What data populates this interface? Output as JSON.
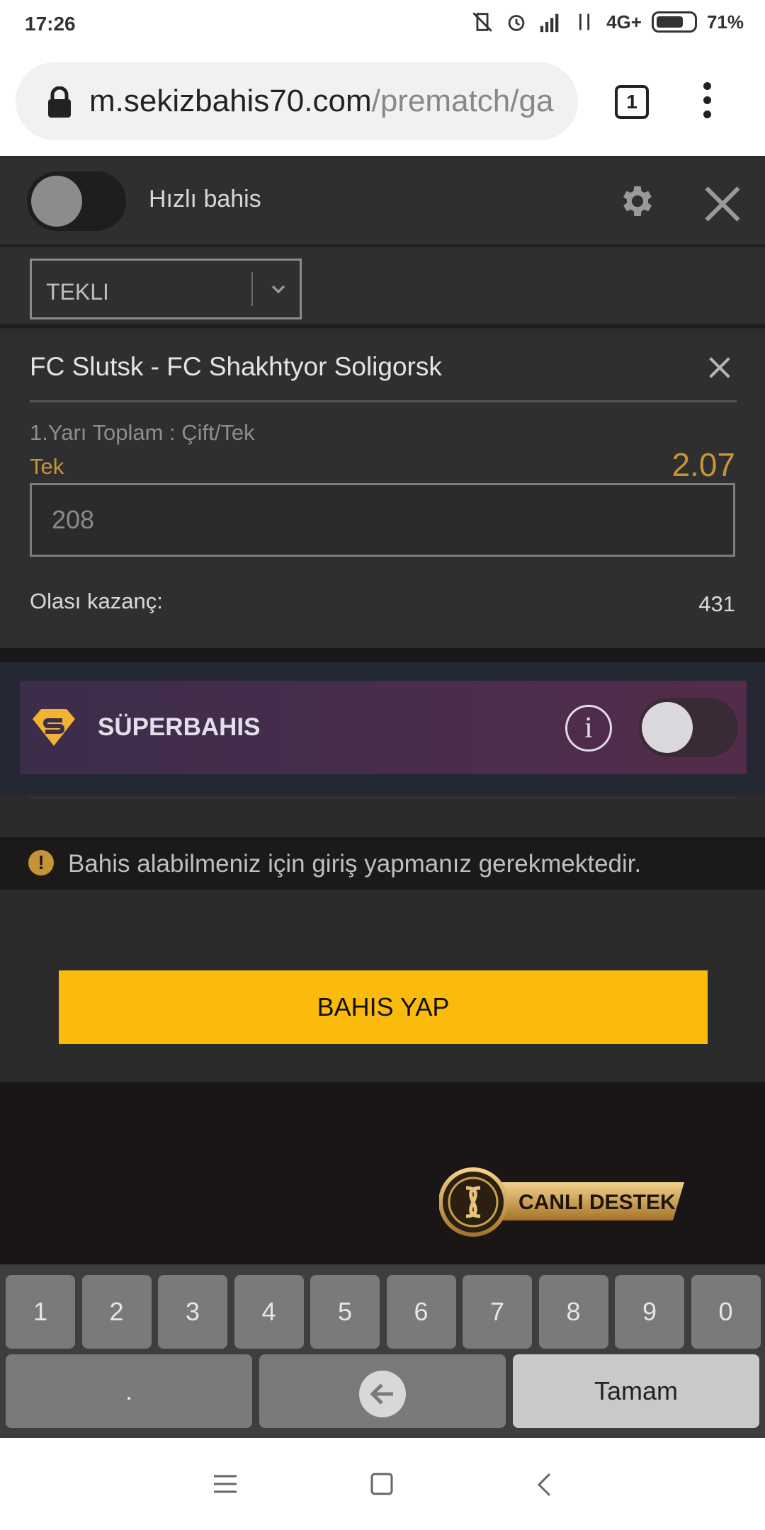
{
  "status_bar": {
    "time": "17:26",
    "network": "4G+",
    "battery": "71%",
    "battery_level": 0.71
  },
  "browser": {
    "url_host": "m.sekizbahis70.com",
    "url_path": "/prematch/ga",
    "tab_count": "1"
  },
  "betslip": {
    "quick_bet_label": "Hızlı bahis",
    "bet_type": "TEKLI",
    "match": "FC Slutsk - FC Shakhtyor Soligorsk",
    "market": "1.Yarı Toplam : Çift/Tek",
    "selection": "Tek",
    "odds": "2.07",
    "stake_value": "208",
    "payout_label": "Olası kazanç:",
    "payout_value": "431"
  },
  "superbahis": {
    "title": "SÜPERBAHIS",
    "info_symbol": "i"
  },
  "alert": {
    "icon": "!",
    "text": "Bahis alabilmeniz için giriş yapmanız gerekmektedir."
  },
  "actions": {
    "place_bet": "BAHIS YAP"
  },
  "support": {
    "label": "CANLI DESTEK"
  },
  "keyboard": {
    "digits": [
      "1",
      "2",
      "3",
      "4",
      "5",
      "6",
      "7",
      "8",
      "9",
      "0"
    ],
    "dot": ".",
    "done": "Tamam"
  },
  "colors": {
    "accent_yellow": "#fbbb0c",
    "odds_gold": "#c69437",
    "panel_dark": "#2f2f2f"
  }
}
